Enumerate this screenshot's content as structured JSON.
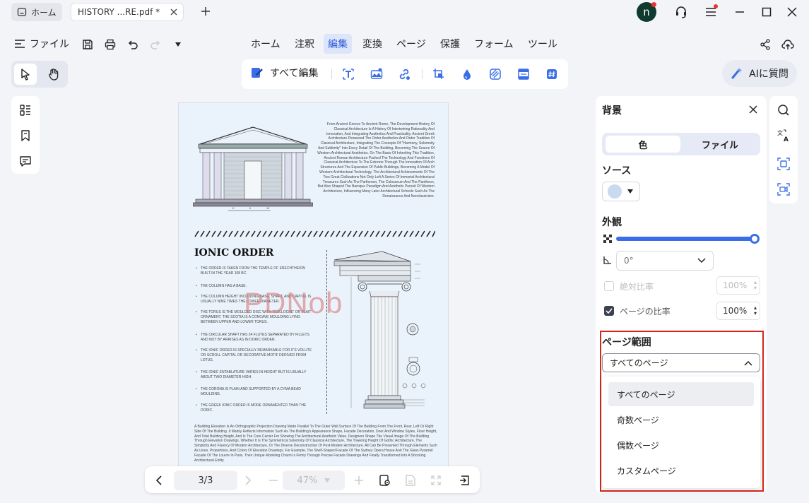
{
  "tabs": {
    "home_label": "ホーム",
    "doc_label": "HISTORY ...RE.pdf *"
  },
  "user": {
    "avatar_initial": "n"
  },
  "menu": {
    "file_label": "ファイル",
    "tabs": [
      "ホーム",
      "注釈",
      "編集",
      "変換",
      "ページ",
      "保護",
      "フォーム",
      "ツール"
    ],
    "active_tab": "編集"
  },
  "edit_toolbar": {
    "edit_all_label": "すべて編集"
  },
  "ai_button": {
    "label": "AIに質問"
  },
  "document": {
    "intro_text": "From Ancient Greece To Ancient Rome, The Development History Of Classical Architecture Is A History Of Intertwining Rationality And Innovation, And Integrating Aesthetics And Practicality. Ancient Greek Architecture Pioneered The Order Aesthetics And Order Tradition Of Classical Architecture, Integrating The Concepts Of \"Harmony, Solemnity And Sublimity\" Into Every Detail Of The Building, Becoming The Source Of Western Architectural Aesthetics. On The Basis Of Inheriting This Tradition, Ancient Roman Architecture Pushed The Technology And Functions Of Classical Architecture To The Extreme Through The Innovation Of Arch Structures And The Expansion Of Public Buildings, Becoming A Model Of Western Architectural Technology. The Architectural Achievements Of The Two Great Civilizations Not Only Left A Series Of Immortal Architectural Treasures Such As The Parthenon, The Colosseum And The Pantheon, But Also Shaped The Baroque Paradigm And Aesthetic Pursuit Of Western Architecture, Influencing Many Later Architectural Schools Such As The Renaissance And Neoclassicism.",
    "heading": "IONIC ORDER",
    "bullets": [
      "THE ORDER IS TAKEN FROM THE TEMPLE OF ERECHTHEION BUILT IN THE YEAR 108 BC.",
      "THE COLUMN HAS A BASE.",
      "THE COLUMN HEIGHT INCLUDING BASE, SHAFT, AND CAPITAL IS USUALLY NINE TIMES THE LOWER DIAMETER.",
      "THE TORUS IS THE MOULDED DISC WITH 'GUILLOCHE' OR PLAIT ORNAMENT. THE SCOTIA IS A CONCAVE MOULDING LYING BETWEEN UPPER AND LOWER TORUS.",
      "THE CIRCULAR SHAFT HAS 24 FLUTES SEPARATED BY FILLETS AND NOT BY ARRISES AS IN DORIC ORDER.",
      "THE IONIC ORDER IS SPECIALLY REMARKABLE FOR ITS VOLUTE OR SCROLL CAPITAL OR DECORATIVE MOTIF DERIVED FROM LOTUS.",
      "THE IONIC ENTABLATURE VARIES IN HEIGHT BUT IS USUALLY ABOUT TWO DIAMETER HIGH.",
      "THE CORONA IS PLAIN AND SUPPORTED BY A CYMA BEAD MOULDING.",
      "THE GREEK IONIC ORDER IS MORE ORNAMENTED THAN THE DORIC."
    ],
    "footer_text": "A Building Elevation Is An Orthographic Projection Drawing Made Parallel To The Outer Wall Surface Of The Building From The Front, Rear, Left Or Right Side Of The Building. It Mainly Reflects Information Such As The Building's Appearance Shape, Facade Decoration, Door And Window Styles, Floor Height, And Total Building Height, And Is The Core Carrier For Showing The Architectural Aesthetic Value. Designers Shape The Visual Image Of The Building Through Elevation Drawings, Whether It Is The Symmetrical Solemnity Of Classical Architecture, The Towering Height Of Gothic Architecture, The Simplicity And Fluency Of Modern Architecture, Or The Diverse Deconstruction Of Post-Modern Architecture. All Can Be Presented Through Elements Such As Lines, Proportions, And Colors Of Elevation Drawings. For Example, The Shelf-Shaped Facade Of The Sydney Opera House And The Glass Pyramid Facade Of The Louvre In Paris. Their Unique Modeling Charm Is Firmly Through Precise Facade Drawings And Finally Transformed Into A Shocking Architectural Entity.",
    "watermark": "PDNob"
  },
  "nav": {
    "page_indicator": "3/3",
    "zoom": "47%"
  },
  "background_panel": {
    "title": "背景",
    "seg_color": "色",
    "seg_file": "ファイル",
    "source_title": "ソース",
    "source_color": "#c8d9f0",
    "appearance_title": "外観",
    "opacity_percent": 100,
    "rotation_value": "0°",
    "absolute_scale_label": "絶対比率",
    "absolute_scale_value": "100%",
    "page_scale_label": "ページの比率",
    "page_scale_value": "100%",
    "page_range_title": "ページ範囲",
    "page_range_selected": "すべてのページ",
    "page_range_options": [
      "すべてのページ",
      "奇数ページ",
      "偶数ページ",
      "カスタムページ"
    ]
  },
  "colors": {
    "accent": "#3a6ee8",
    "highlight_box": "#d9251c",
    "active_tab_bg": "#dde5fb"
  }
}
